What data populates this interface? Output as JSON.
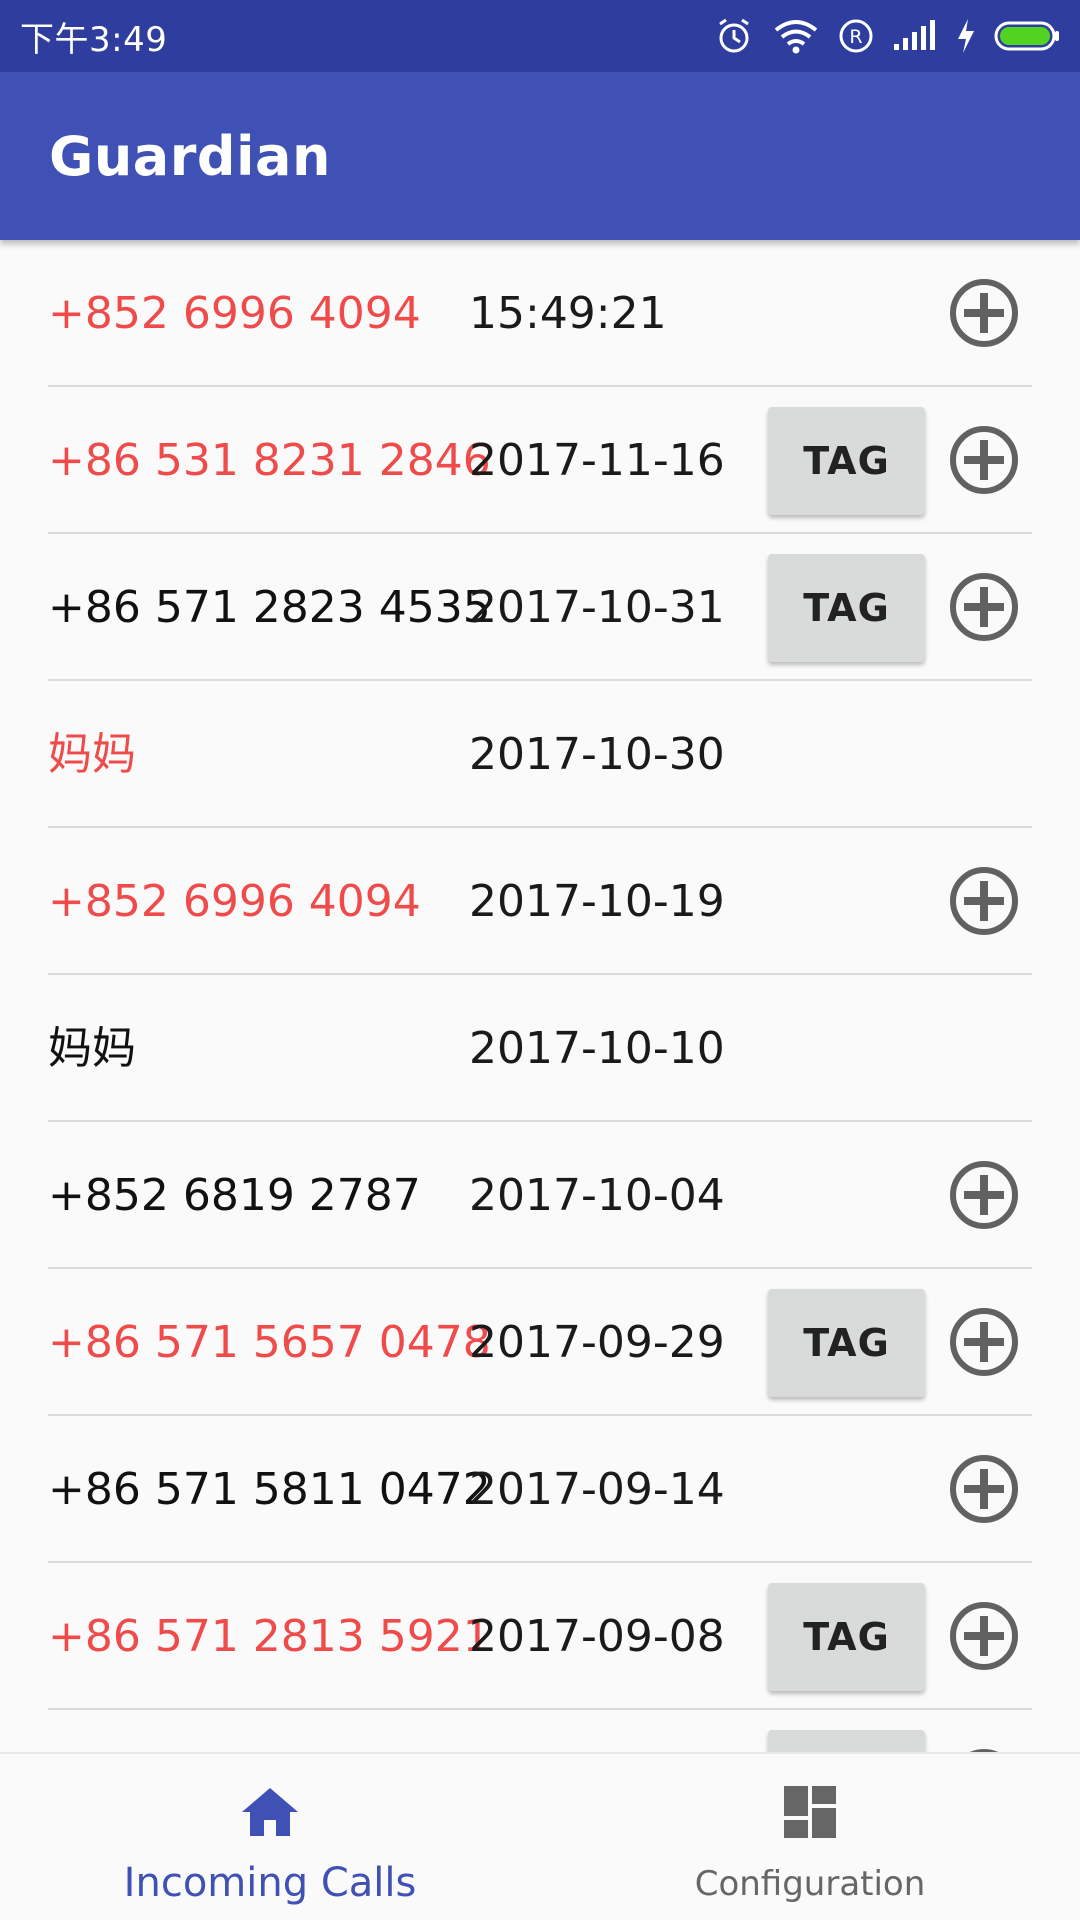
{
  "status_bar": {
    "time": "下午3:49",
    "icons": [
      "alarm-icon",
      "wifi-icon",
      "registered-icon",
      "signal-icon",
      "charging-icon",
      "battery-icon"
    ]
  },
  "app_bar": {
    "title": "Guardian"
  },
  "calls": [
    {
      "number": "+852 6996 4094",
      "date": "15:49:21",
      "color": "#f04b4b",
      "tag": null,
      "add": true
    },
    {
      "number": "+86 531 8231 2846",
      "date": "2017-11-16",
      "color": "#f04b4b",
      "tag": "TAG",
      "add": true
    },
    {
      "number": "+86 571 2823 4535",
      "date": "2017-10-31",
      "color": "#111111",
      "tag": "TAG",
      "add": true
    },
    {
      "number": "妈妈",
      "date": "2017-10-30",
      "color": "#f04b4b",
      "tag": null,
      "add": false
    },
    {
      "number": "+852 6996 4094",
      "date": "2017-10-19",
      "color": "#f04b4b",
      "tag": null,
      "add": true
    },
    {
      "number": "妈妈",
      "date": "2017-10-10",
      "color": "#111111",
      "tag": null,
      "add": false
    },
    {
      "number": "+852 6819 2787",
      "date": "2017-10-04",
      "color": "#111111",
      "tag": null,
      "add": true
    },
    {
      "number": "+86 571 5657 0478",
      "date": "2017-09-29",
      "color": "#f04b4b",
      "tag": "TAG",
      "add": true
    },
    {
      "number": "+86 571 5811 0472",
      "date": "2017-09-14",
      "color": "#111111",
      "tag": null,
      "add": true
    },
    {
      "number": "+86 571 2813 5921",
      "date": "2017-09-08",
      "color": "#f04b4b",
      "tag": "TAG",
      "add": true
    },
    {
      "number": "",
      "date": "",
      "color": "#111111",
      "tag": "TAG",
      "add": true
    }
  ],
  "bottom_nav": {
    "items": [
      {
        "label": "Incoming Calls",
        "icon": "home-icon",
        "active": true
      },
      {
        "label": "Configuration",
        "icon": "dashboard-icon",
        "active": false
      }
    ]
  },
  "colors": {
    "primary": "#3f51b5",
    "primary_dark": "#2f3e9e",
    "highlight_red": "#f04b4b"
  }
}
